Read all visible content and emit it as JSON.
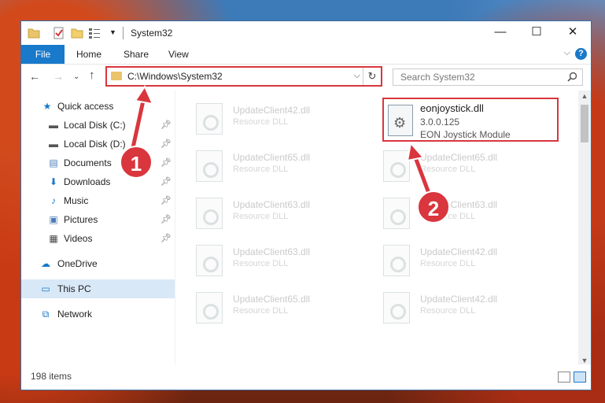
{
  "window": {
    "title": "System32",
    "controls": {
      "minimize": "—",
      "maximize": "☐",
      "close": "✕"
    }
  },
  "ribbon": {
    "file_tab": "File",
    "tabs": [
      "Home",
      "Share",
      "View"
    ],
    "help": "?"
  },
  "address": {
    "path": "C:\\Windows\\System32",
    "search_placeholder": "Search System32"
  },
  "sidebar": {
    "quick_access": "Quick access",
    "items": [
      {
        "label": "Local Disk (C:)",
        "icon": "drive-icon"
      },
      {
        "label": "Local Disk (D:)",
        "icon": "drive-icon"
      },
      {
        "label": "Documents",
        "icon": "documents-icon"
      },
      {
        "label": "Downloads",
        "icon": "downloads-icon"
      },
      {
        "label": "Music",
        "icon": "music-icon"
      },
      {
        "label": "Pictures",
        "icon": "pictures-icon"
      },
      {
        "label": "Videos",
        "icon": "videos-icon"
      }
    ],
    "onedrive": "OneDrive",
    "this_pc": "This PC",
    "network": "Network"
  },
  "files": {
    "faded_left": [
      {
        "name": "UpdateClient42.dll",
        "type": "Resource DLL"
      },
      {
        "name": "UpdateClient65.dll",
        "type": "Resource DLL"
      },
      {
        "name": "UpdateClient63.dll",
        "type": "Resource DLL"
      },
      {
        "name": "UpdateClient63.dll",
        "type": "Resource DLL"
      },
      {
        "name": "UpdateClient65.dll",
        "type": "Resource DLL"
      }
    ],
    "faded_right": [
      {
        "name": "UpdateClient65.dll",
        "type": "Resource DLL"
      },
      {
        "name": "UpdateClient63.dll",
        "type": "Resource DLL"
      },
      {
        "name": "UpdateClient42.dll",
        "type": "Resource DLL"
      },
      {
        "name": "UpdateClient42.dll",
        "type": "Resource DLL"
      }
    ],
    "highlighted": {
      "name": "eonjoystick.dll",
      "version": "3.0.0.125",
      "description": "EON Joystick Module"
    }
  },
  "status": {
    "item_count": "198 items"
  },
  "annotations": {
    "step1": "1",
    "step2": "2",
    "color": "#d9363e"
  }
}
